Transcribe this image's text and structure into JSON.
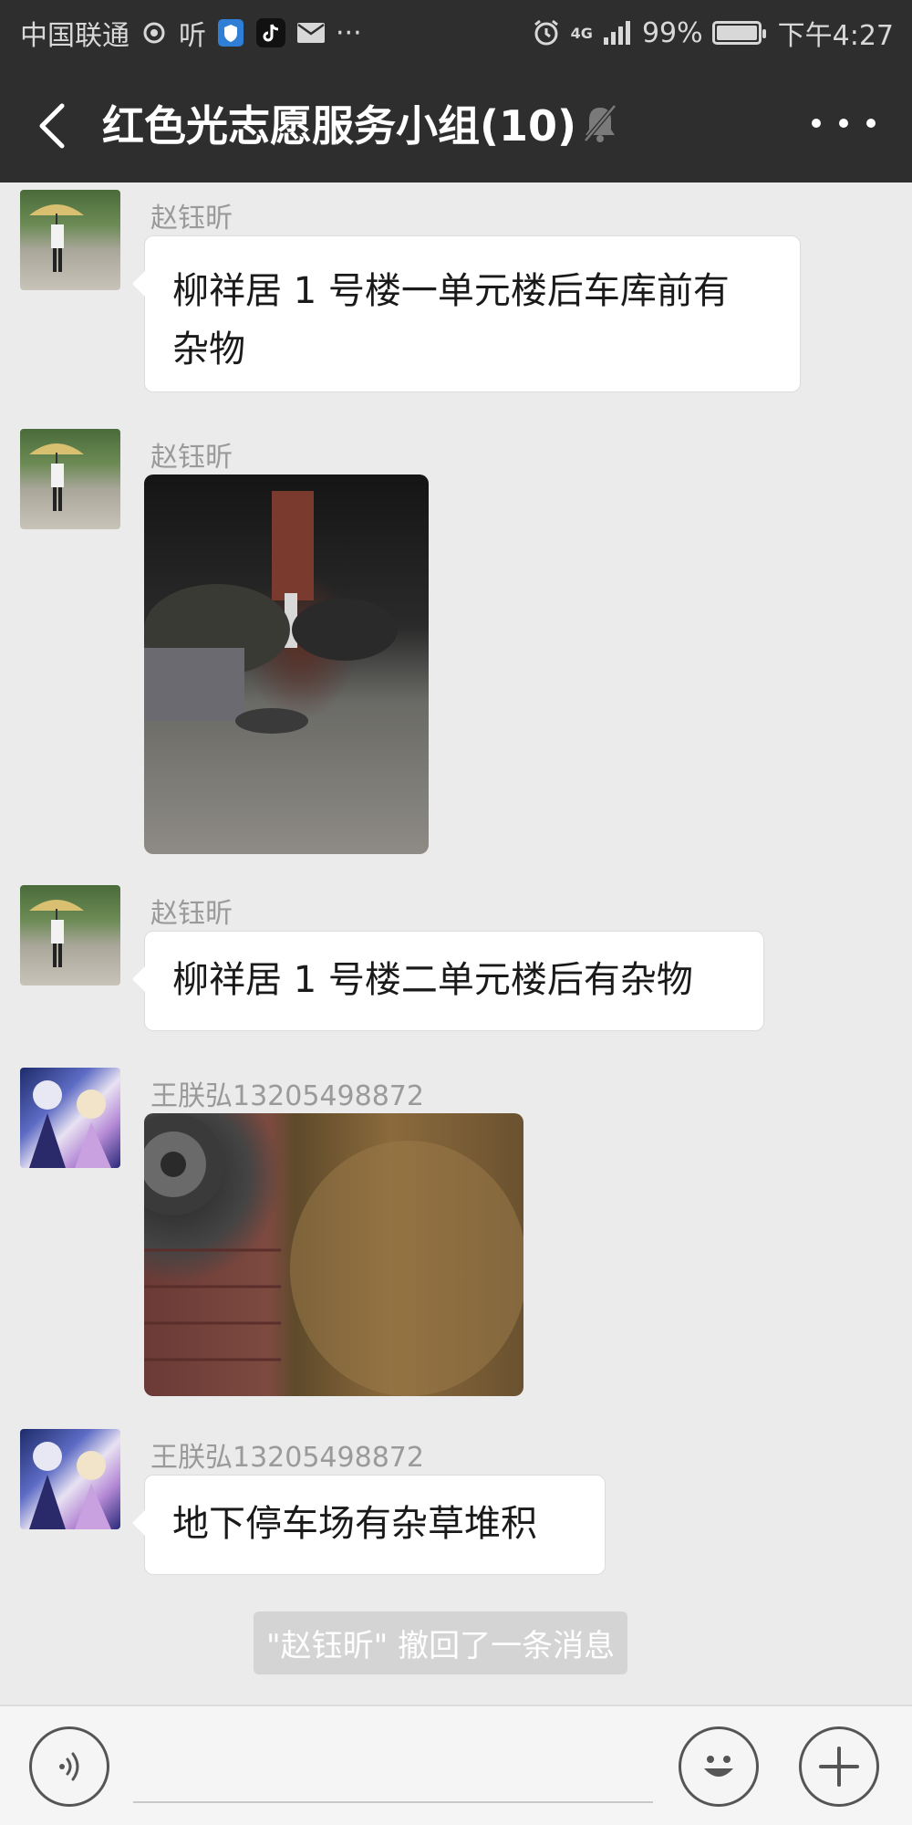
{
  "status_bar": {
    "carrier": "中国联通",
    "extra_app": "听",
    "more": "···",
    "network": "4G",
    "battery": "99%",
    "time": "下午4:27"
  },
  "header": {
    "title": "红色光志愿服务小组(10)"
  },
  "messages": [
    {
      "type": "text",
      "sender": "赵钰昕",
      "lines": [
        "柳祥居 1 号楼一单元楼后车库前有",
        "杂物"
      ]
    },
    {
      "type": "image",
      "sender": "赵钰昕"
    },
    {
      "type": "text",
      "sender": "赵钰昕",
      "lines": [
        "柳祥居 1 号楼二单元楼后有杂物"
      ]
    },
    {
      "type": "image",
      "sender": "王朕弘13205498872"
    },
    {
      "type": "text",
      "sender": "王朕弘13205498872",
      "lines": [
        "地下停车场有杂草堆积"
      ]
    }
  ],
  "system_tip": "\"赵钰昕\" 撤回了一条消息",
  "colors": {
    "header_bg": "#2e2e2e",
    "chat_bg": "#ebebeb",
    "bubble_bg": "#ffffff"
  }
}
